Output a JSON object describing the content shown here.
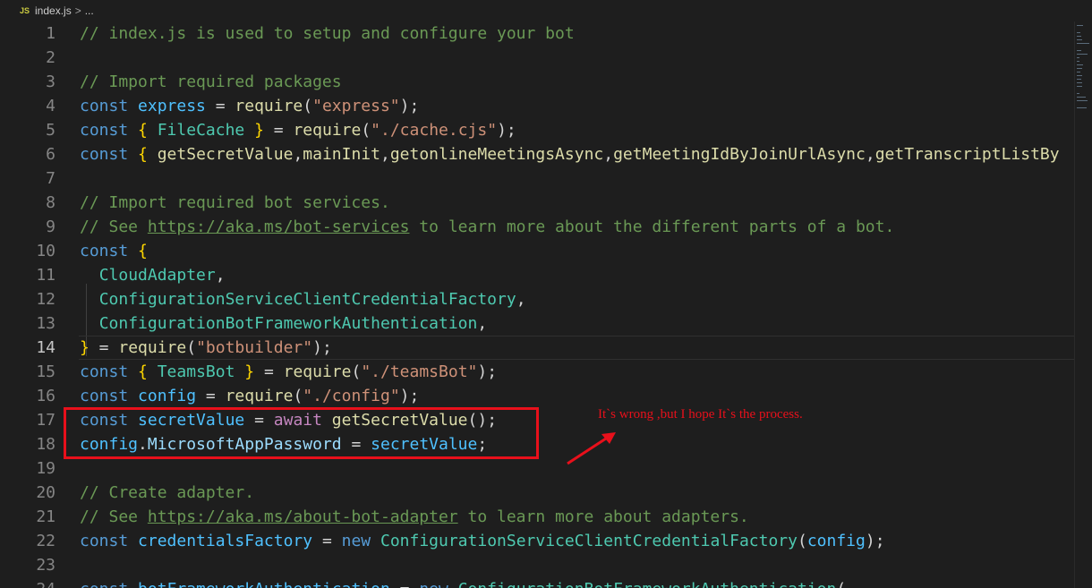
{
  "breadcrumb": {
    "file_icon": "JS",
    "file": "index.js",
    "separator": ">",
    "rest": "..."
  },
  "active_line": 14,
  "lines": [
    {
      "n": "1",
      "t": [
        [
          "c",
          "// index.js is used to setup and configure your bot"
        ]
      ]
    },
    {
      "n": "2",
      "t": []
    },
    {
      "n": "3",
      "t": [
        [
          "c",
          "// Import required packages"
        ]
      ]
    },
    {
      "n": "4",
      "t": [
        [
          "k",
          "const "
        ],
        [
          "cv",
          "express"
        ],
        [
          "p",
          " = "
        ],
        [
          "f",
          "require"
        ],
        [
          "p",
          "("
        ],
        [
          "s",
          "\"express\""
        ],
        [
          "p",
          ");"
        ]
      ]
    },
    {
      "n": "5",
      "t": [
        [
          "k",
          "const "
        ],
        [
          "b1",
          "{ "
        ],
        [
          "cls",
          "FileCache"
        ],
        [
          "b1",
          " }"
        ],
        [
          "p",
          " = "
        ],
        [
          "f",
          "require"
        ],
        [
          "p",
          "("
        ],
        [
          "s",
          "\"./cache.cjs\""
        ],
        [
          "p",
          ");"
        ]
      ]
    },
    {
      "n": "6",
      "t": [
        [
          "k",
          "const "
        ],
        [
          "b1",
          "{ "
        ],
        [
          "f",
          "getSecretValue"
        ],
        [
          "p",
          ","
        ],
        [
          "f",
          "mainInit"
        ],
        [
          "p",
          ","
        ],
        [
          "f",
          "getonlineMeetingsAsync"
        ],
        [
          "p",
          ","
        ],
        [
          "f",
          "getMeetingIdByJoinUrlAsync"
        ],
        [
          "p",
          ","
        ],
        [
          "f",
          "getTranscriptListBy"
        ]
      ]
    },
    {
      "n": "7",
      "t": []
    },
    {
      "n": "8",
      "t": [
        [
          "c",
          "// Import required bot services."
        ]
      ]
    },
    {
      "n": "9",
      "t": [
        [
          "c",
          "// See "
        ],
        [
          "cu",
          "https://aka.ms/bot-services"
        ],
        [
          "c",
          " to learn more about the different parts of a bot."
        ]
      ]
    },
    {
      "n": "10",
      "t": [
        [
          "k",
          "const "
        ],
        [
          "b1",
          "{"
        ]
      ]
    },
    {
      "n": "11",
      "t": [
        [
          "p",
          "  "
        ],
        [
          "cls",
          "CloudAdapter"
        ],
        [
          "p",
          ","
        ]
      ]
    },
    {
      "n": "12",
      "t": [
        [
          "p",
          "  "
        ],
        [
          "cls",
          "ConfigurationServiceClientCredentialFactory"
        ],
        [
          "p",
          ","
        ]
      ]
    },
    {
      "n": "13",
      "t": [
        [
          "p",
          "  "
        ],
        [
          "cls",
          "ConfigurationBotFrameworkAuthentication"
        ],
        [
          "p",
          ","
        ]
      ]
    },
    {
      "n": "14",
      "t": [
        [
          "b1",
          "}"
        ],
        [
          "p",
          " = "
        ],
        [
          "f",
          "require"
        ],
        [
          "p",
          "("
        ],
        [
          "s",
          "\"botbuilder\""
        ],
        [
          "p",
          ");"
        ]
      ]
    },
    {
      "n": "15",
      "t": [
        [
          "k",
          "const "
        ],
        [
          "b1",
          "{ "
        ],
        [
          "cls",
          "TeamsBot"
        ],
        [
          "b1",
          " }"
        ],
        [
          "p",
          " = "
        ],
        [
          "f",
          "require"
        ],
        [
          "p",
          "("
        ],
        [
          "s",
          "\"./teamsBot\""
        ],
        [
          "p",
          ");"
        ]
      ]
    },
    {
      "n": "16",
      "t": [
        [
          "k",
          "const "
        ],
        [
          "cv",
          "config"
        ],
        [
          "p",
          " = "
        ],
        [
          "f",
          "require"
        ],
        [
          "p",
          "("
        ],
        [
          "s",
          "\"./config\""
        ],
        [
          "p",
          ");"
        ]
      ]
    },
    {
      "n": "17",
      "t": [
        [
          "k",
          "const "
        ],
        [
          "cv",
          "secretValue"
        ],
        [
          "p",
          " = "
        ],
        [
          "aw",
          "await "
        ],
        [
          "f",
          "getSecretValue"
        ],
        [
          "p",
          "();"
        ]
      ]
    },
    {
      "n": "18",
      "t": [
        [
          "cv",
          "config"
        ],
        [
          "p",
          "."
        ],
        [
          "v",
          "MicrosoftAppPassword"
        ],
        [
          "p",
          " = "
        ],
        [
          "cv",
          "secretValue"
        ],
        [
          "p",
          ";"
        ]
      ]
    },
    {
      "n": "19",
      "t": []
    },
    {
      "n": "20",
      "t": [
        [
          "c",
          "// Create adapter."
        ]
      ]
    },
    {
      "n": "21",
      "t": [
        [
          "c",
          "// See "
        ],
        [
          "cu",
          "https://aka.ms/about-bot-adapter"
        ],
        [
          "c",
          " to learn more about adapters."
        ]
      ]
    },
    {
      "n": "22",
      "t": [
        [
          "k",
          "const "
        ],
        [
          "cv",
          "credentialsFactory"
        ],
        [
          "p",
          " = "
        ],
        [
          "k",
          "new "
        ],
        [
          "cls",
          "ConfigurationServiceClientCredentialFactory"
        ],
        [
          "p",
          "("
        ],
        [
          "cv",
          "config"
        ],
        [
          "p",
          ");"
        ]
      ]
    },
    {
      "n": "23",
      "t": []
    },
    {
      "n": "24",
      "t": [
        [
          "k",
          "const "
        ],
        [
          "cv",
          "botFrameworkAuthentication"
        ],
        [
          "p",
          " = "
        ],
        [
          "k",
          "new "
        ],
        [
          "cls",
          "ConfigurationBotFrameworkAuthentication"
        ],
        [
          "p",
          "("
        ]
      ]
    }
  ],
  "annotation": {
    "text": "It`s wrong ,but I hope It`s the process."
  },
  "colors": {
    "highlight": "#e8101b"
  }
}
